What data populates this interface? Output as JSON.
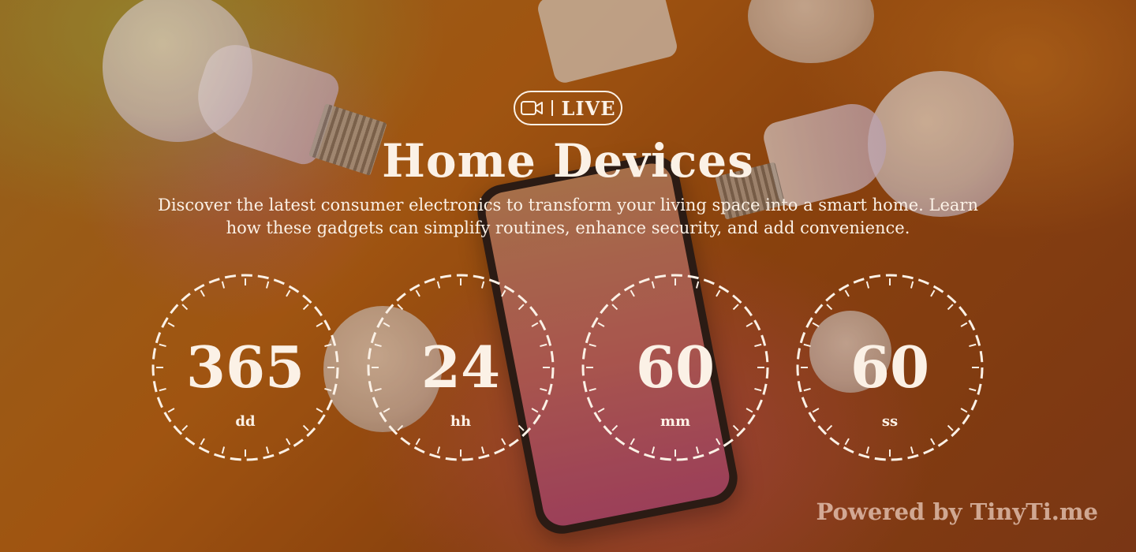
{
  "badge": {
    "icon": "video-camera-icon",
    "label": "LIVE"
  },
  "title": "Home Devices",
  "description": "Discover the latest consumer electronics to transform your living space into a smart home. Learn how these gadgets can simplify routines, enhance security, and add convenience.",
  "countdown": [
    {
      "value": "365",
      "unit": "dd"
    },
    {
      "value": "24",
      "unit": "hh"
    },
    {
      "value": "60",
      "unit": "mm"
    },
    {
      "value": "60",
      "unit": "ss"
    }
  ],
  "powered_by": "Powered by TinyTi.me",
  "colors": {
    "text": "#fbf1e6",
    "background": "#a95a10",
    "watermark": "#f0d2c3"
  }
}
